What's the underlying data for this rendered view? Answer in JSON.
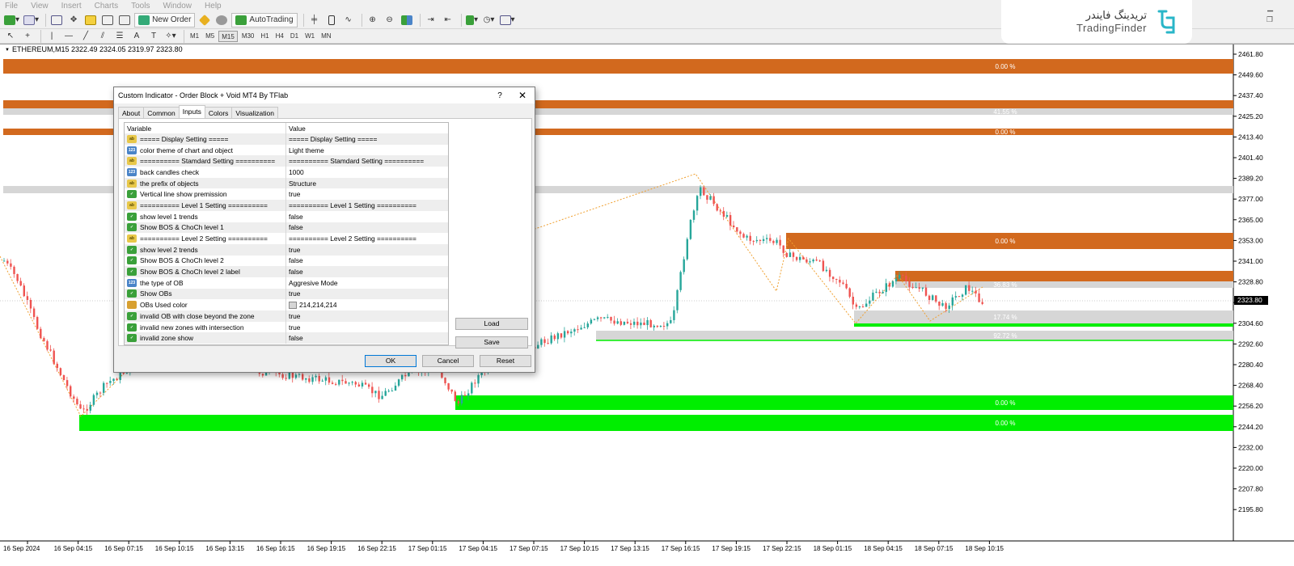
{
  "menu": [
    "File",
    "View",
    "Insert",
    "Charts",
    "Tools",
    "Window",
    "Help"
  ],
  "toolbar": {
    "new_order": "New Order",
    "auto_trading": "AutoTrading",
    "timeframes": [
      "M1",
      "M5",
      "M15",
      "M30",
      "H1",
      "H4",
      "D1",
      "W1",
      "MN"
    ],
    "active_timeframe": "M15"
  },
  "logo": {
    "persian": "تریدینگ فایندر",
    "english": "TradingFinder"
  },
  "chart": {
    "symbol_line": "ETHEREUM,M15  2322.49 2324.05 2319.97 2323.80",
    "current_price": "2323.80",
    "price_labels": [
      "2461.80",
      "2449.60",
      "2437.40",
      "2425.20",
      "2413.40",
      "2401.40",
      "2389.20",
      "2377.00",
      "2365.00",
      "2353.00",
      "2341.00",
      "2328.80",
      "2316.80",
      "2304.60",
      "2292.60",
      "2280.40",
      "2268.40",
      "2256.20",
      "2244.20",
      "2232.00",
      "2220.00",
      "2207.80",
      "2195.80"
    ],
    "time_labels": [
      "16 Sep 2024",
      "16 Sep 04:15",
      "16 Sep 07:15",
      "16 Sep 10:15",
      "16 Sep 13:15",
      "16 Sep 16:15",
      "16 Sep 19:15",
      "16 Sep 22:15",
      "17 Sep 01:15",
      "17 Sep 04:15",
      "17 Sep 07:15",
      "17 Sep 10:15",
      "17 Sep 13:15",
      "17 Sep 16:15",
      "17 Sep 19:15",
      "17 Sep 22:15",
      "18 Sep 01:15",
      "18 Sep 04:15",
      "18 Sep 07:15",
      "18 Sep 10:15"
    ],
    "zone_labels": [
      "0.00 %",
      "41.55 %",
      "0.00 %",
      "0.00 %",
      "36.83 %",
      "17.74 %",
      "92.72 %",
      "0.00 %",
      "0.00 %"
    ],
    "colors": {
      "bull": "#26a69a",
      "bear": "#ef5350",
      "supply": "#d2691e",
      "demand": "#00ee00",
      "zone_gray": "#d6d6d6"
    }
  },
  "dialog": {
    "title": "Custom Indicator - Order Block + Void MT4 By TFlab",
    "help": "?",
    "close": "✕",
    "tabs": [
      "About",
      "Common",
      "Inputs",
      "Colors",
      "Visualization"
    ],
    "active_tab": "Inputs",
    "columns": {
      "variable": "Variable",
      "value": "Value"
    },
    "params": [
      {
        "type": "ab",
        "type_icon": "ab",
        "variable": "===== Display Setting =====",
        "value": "===== Display Setting ====="
      },
      {
        "type": "num",
        "type_icon": "123",
        "variable": "color theme of chart and object",
        "value": "Light theme"
      },
      {
        "type": "ab",
        "type_icon": "ab",
        "variable": "========== Stamdard Setting ==========",
        "value": "========== Stamdard Setting =========="
      },
      {
        "type": "num",
        "type_icon": "123",
        "variable": "back candles check",
        "value": "1000"
      },
      {
        "type": "ab",
        "type_icon": "ab",
        "variable": "the prefix of objects",
        "value": "Structure"
      },
      {
        "type": "bool",
        "type_icon": "✓",
        "variable": "Vertical line show premission",
        "value": "true"
      },
      {
        "type": "ab",
        "type_icon": "ab",
        "variable": "========== Level 1 Setting ==========",
        "value": "========== Level 1 Setting =========="
      },
      {
        "type": "bool",
        "type_icon": "✓",
        "variable": "show level 1 trends",
        "value": "false"
      },
      {
        "type": "bool",
        "type_icon": "✓",
        "variable": "Show BOS & ChoCh level 1",
        "value": "false"
      },
      {
        "type": "ab",
        "type_icon": "ab",
        "variable": "========== Level 2 Setting ==========",
        "value": "========== Level 2 Setting =========="
      },
      {
        "type": "bool",
        "type_icon": "✓",
        "variable": "show level 2 trends",
        "value": "true"
      },
      {
        "type": "bool",
        "type_icon": "✓",
        "variable": "Show BOS & ChoCh level 2",
        "value": "false"
      },
      {
        "type": "bool",
        "type_icon": "✓",
        "variable": "Show BOS & ChoCh level 2 label",
        "value": "false"
      },
      {
        "type": "num",
        "type_icon": "123",
        "variable": "the type of OB",
        "value": "Aggresive Mode"
      },
      {
        "type": "bool",
        "type_icon": "✓",
        "variable": "Show OBs",
        "value": "true"
      },
      {
        "type": "clr",
        "type_icon": "",
        "variable": "OBs Used color",
        "value": "214,214,214",
        "swatch": "#d6d6d6"
      },
      {
        "type": "bool",
        "type_icon": "✓",
        "variable": "invalid OB with close beyond the zone",
        "value": "true"
      },
      {
        "type": "bool",
        "type_icon": "✓",
        "variable": "invalid new zones with intersection",
        "value": "true"
      },
      {
        "type": "bool",
        "type_icon": "✓",
        "variable": "invalid zone show",
        "value": "false"
      }
    ],
    "buttons": {
      "load": "Load",
      "save": "Save",
      "ok": "OK",
      "cancel": "Cancel",
      "reset": "Reset"
    }
  }
}
